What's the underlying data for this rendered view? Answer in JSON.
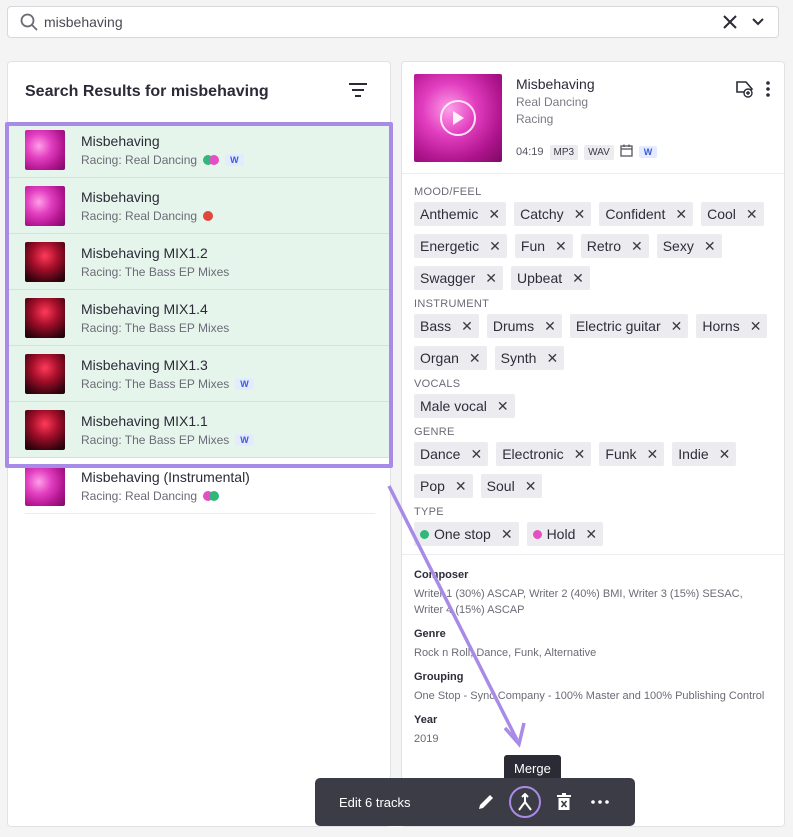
{
  "search": {
    "value": "misbehaving"
  },
  "results": {
    "heading": "Search Results for misbehaving",
    "items": [
      {
        "title": "Misbehaving",
        "subtitle": "Racing: Real Dancing",
        "thumb": "pink",
        "dots": [
          "green",
          "pink"
        ],
        "badge": "W",
        "selected": true
      },
      {
        "title": "Misbehaving",
        "subtitle": "Racing: Real Dancing",
        "thumb": "pink",
        "dots": [
          "red"
        ],
        "badge": "",
        "selected": true
      },
      {
        "title": "Misbehaving MIX1.2",
        "subtitle": "Racing: The Bass EP Mixes",
        "thumb": "red",
        "dots": [],
        "badge": "",
        "selected": true
      },
      {
        "title": "Misbehaving MIX1.4",
        "subtitle": "Racing: The Bass EP Mixes",
        "thumb": "red",
        "dots": [],
        "badge": "",
        "selected": true
      },
      {
        "title": "Misbehaving MIX1.3",
        "subtitle": "Racing: The Bass EP Mixes",
        "thumb": "red",
        "dots": [],
        "badge": "W",
        "selected": true
      },
      {
        "title": "Misbehaving MIX1.1",
        "subtitle": "Racing: The Bass EP Mixes",
        "thumb": "red",
        "dots": [],
        "badge": "W",
        "selected": true
      },
      {
        "title": "Misbehaving (Instrumental)",
        "subtitle": "Racing: Real Dancing",
        "thumb": "pink",
        "dots": [
          "pink",
          "green"
        ],
        "badge": "",
        "selected": false
      }
    ]
  },
  "track": {
    "title": "Misbehaving",
    "album": "Real Dancing",
    "artist": "Racing",
    "duration": "04:19",
    "formats": [
      "MP3",
      "WAV"
    ],
    "badge": "W"
  },
  "tag_groups": [
    {
      "label": "MOOD/FEEL",
      "tags": [
        "Anthemic",
        "Catchy",
        "Confident",
        "Cool",
        "Energetic",
        "Fun",
        "Retro",
        "Sexy",
        "Swagger",
        "Upbeat"
      ]
    },
    {
      "label": "INSTRUMENT",
      "tags": [
        "Bass",
        "Drums",
        "Electric guitar",
        "Horns",
        "Organ",
        "Synth"
      ]
    },
    {
      "label": "VOCALS",
      "tags": [
        "Male vocal"
      ]
    },
    {
      "label": "GENRE",
      "tags": [
        "Dance",
        "Electronic",
        "Funk",
        "Indie",
        "Pop",
        "Soul"
      ]
    },
    {
      "label": "TYPE",
      "tags": [
        "One stop",
        "Hold"
      ],
      "dots": [
        "#2fb87a",
        "#e54fc1"
      ]
    }
  ],
  "details": [
    {
      "label": "Composer",
      "value": "Writer 1 (30%) ASCAP, Writer 2 (40%) BMI, Writer 3 (15%) SESAC, Writer 4 (15%) ASCAP"
    },
    {
      "label": "Genre",
      "value": "Rock n Roll, Dance, Funk, Alternative"
    },
    {
      "label": "Grouping",
      "value": "One Stop - Sync Company - 100% Master and 100% Publishing Control"
    },
    {
      "label": "Year",
      "value": "2019"
    }
  ],
  "toolbar": {
    "edit_label": "Edit 6 tracks",
    "tooltip": "Merge"
  },
  "colors": {
    "selection_border": "#a88be6",
    "selected_row_bg": "#e6f5ec",
    "toolbar_bg": "#3c3c46"
  }
}
